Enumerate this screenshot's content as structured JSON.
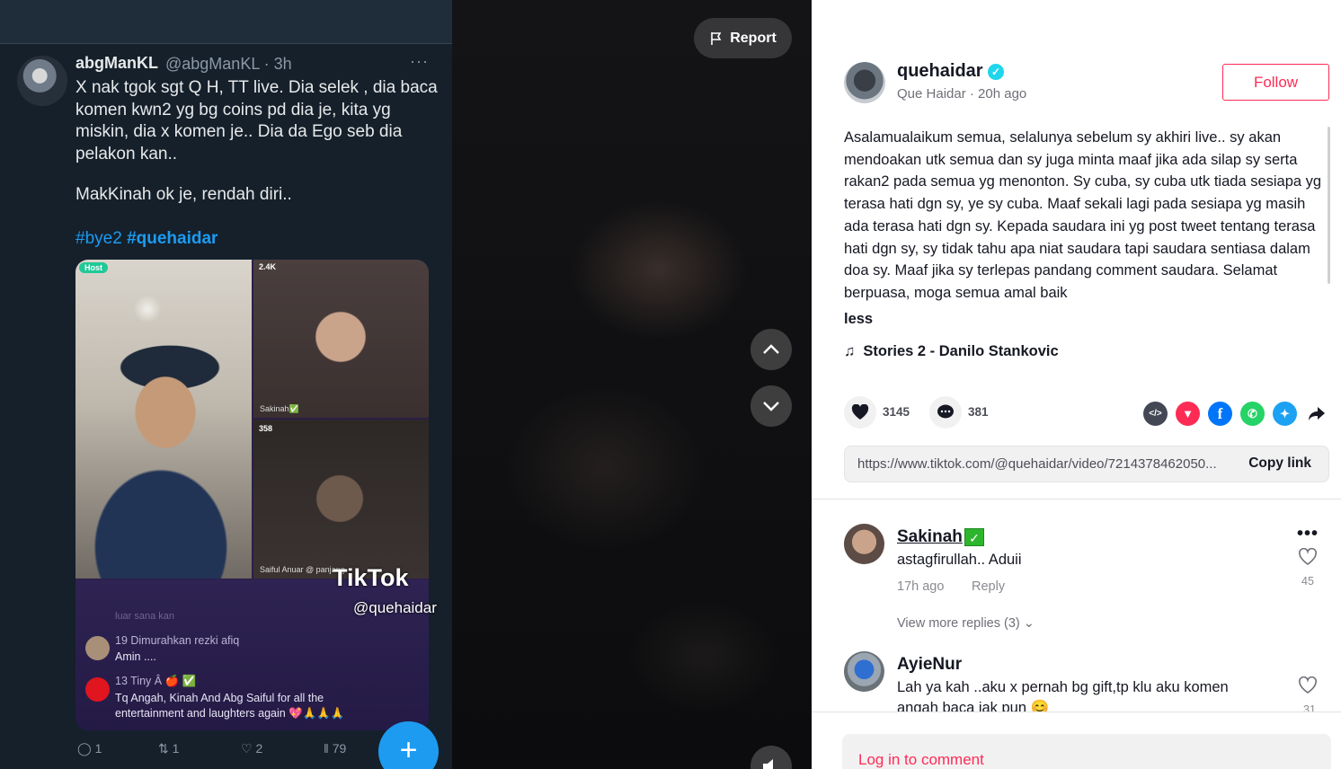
{
  "tweet": {
    "name": "abgManKL",
    "handle": "@abgManKL · 3h",
    "more": "···",
    "text": "X nak tgok sgt Q H, TT live.  Dia selek  , dia baca komen kwn2 yg bg coins pd dia je, kita yg miskin,  dia x komen je.. Dia da Ego seb dia pelakon kan..",
    "text2": "MakKinah ok je, rendah diri..",
    "tags": [
      "#bye2",
      "#quehaidar"
    ],
    "media": {
      "host_badge": "Host",
      "guest1_count": "2.4K",
      "guest1_name": "Sakinah✅",
      "guest2_count": "358",
      "guest2_name": "Saiful Anuar @ panjang",
      "chat_faded": "luar sana kan",
      "chat1_meta": "19  Dimurahkan rezki afiq",
      "chat1_text": "Amin ....",
      "chat2_meta": "13  Tiny Â 🍎 ✅",
      "chat2_text1": "Tq Angah, Kinah And Abg Saiful for all the",
      "chat2_text2": "entertainment and laughters again 💖🙏🙏🙏",
      "tiktok_logo": "TikTok",
      "tiktok_handle": "@quehaidar"
    },
    "actions": {
      "replies": "1",
      "retweets": "1",
      "likes": "2",
      "views": "79"
    },
    "fab": "+"
  },
  "video": {
    "report_label": "Report"
  },
  "author": {
    "username": "quehaidar",
    "verified": true,
    "subline": "Que Haidar · 20h ago",
    "follow_label": "Follow"
  },
  "caption": "Asalamualaikum semua, selalunya sebelum sy akhiri live.. sy akan mendoakan utk semua dan sy juga minta maaf jika ada silap sy serta rakan2 pada semua yg menonton. Sy cuba, sy cuba utk tiada sesiapa yg terasa hati dgn sy, ye sy cuba. Maaf sekali lagi pada sesiapa yg masih ada terasa hati dgn sy. Kepada saudara ini yg post tweet tentang terasa hati dgn sy, sy tidak tahu apa niat saudara tapi saudara sentiasa dalam doa sy. Maaf jika sy terlepas pandang comment saudara. Selamat berpuasa, moga semua amal baik",
  "less_label": "less",
  "music": "Stories 2 - Danilo Stankovic",
  "stats": {
    "likes": "3145",
    "comments": "381"
  },
  "share": {
    "link": "https://www.tiktok.com/@quehaidar/video/7214378462050...",
    "copy_label": "Copy link",
    "icons": [
      "embed-icon",
      "pinterest-icon",
      "facebook-icon",
      "whatsapp-icon",
      "twitter-icon",
      "share-arrow-icon"
    ]
  },
  "comments": [
    {
      "user": "Sakinah",
      "text": "astagfirullah.. Aduii",
      "time": "17h ago",
      "reply_label": "Reply",
      "more_replies": "View more replies (3)",
      "likes": "45"
    },
    {
      "user": "AyieNur",
      "text": "Lah ya kah ..aku x pernah bg gift,tp klu aku komen",
      "text2": "angah baca jak pun 😊",
      "likes": "31"
    }
  ],
  "login_prompt": "Log in to comment",
  "colors": {
    "tiktok_red": "#fe2c55",
    "twitter_bg": "#15202b",
    "twitter_blue": "#1d9bf0"
  }
}
